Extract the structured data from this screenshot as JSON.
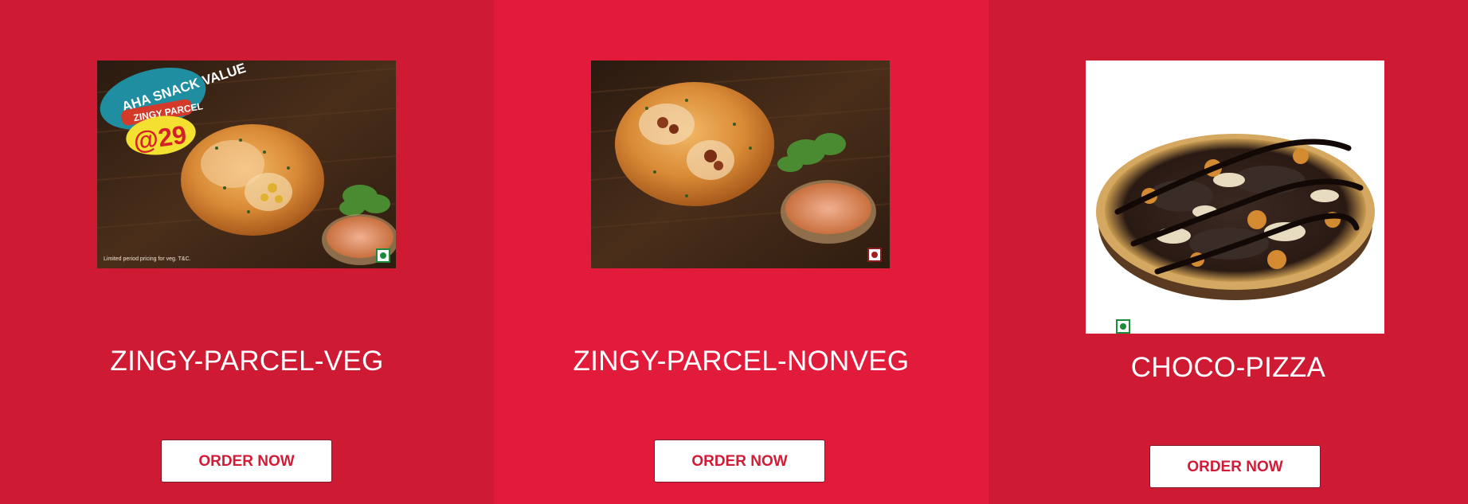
{
  "products": [
    {
      "title": "ZINGY-PARCEL-VEG",
      "button_label": "ORDER NOW",
      "image_icon": "zingy-parcel-veg-photo",
      "diet_mark": "veg-mark-icon",
      "promo": {
        "line1": "AHA SNACK VALUE",
        "line2": "ZINGY PARCEL",
        "price": "@29"
      },
      "fineprint": "Limited period pricing for veg. T&C."
    },
    {
      "title": "ZINGY-PARCEL-NONVEG",
      "button_label": "ORDER NOW",
      "image_icon": "zingy-parcel-nonveg-photo",
      "diet_mark": "nonveg-mark-icon"
    },
    {
      "title": "CHOCO-PIZZA",
      "button_label": "ORDER NOW",
      "image_icon": "choco-pizza-photo",
      "diet_mark": "veg-mark-icon"
    }
  ],
  "colors": {
    "panel_dark": "#cf1a34",
    "panel_light": "#e31b3a",
    "button_text": "#d21b36",
    "veg_green": "#1a8c3a",
    "nonveg_maroon": "#8b1a1a"
  }
}
